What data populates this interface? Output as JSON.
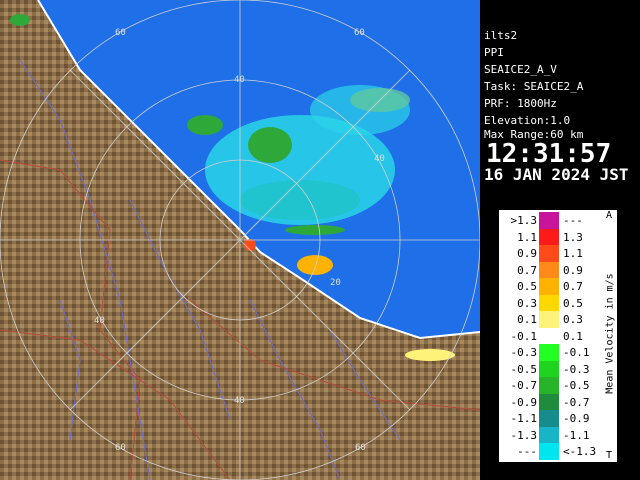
{
  "info": {
    "station": "ilts2",
    "mode": "PPI",
    "product": "SEAICE2_A_V",
    "task": "Task: SEAICE2_A",
    "prf": "PRF: 1800Hz",
    "elevation": "Elevation:1.0",
    "max_range": "Max Range:60 km",
    "time": "12:31:57",
    "date": "16 JAN 2024 JST"
  },
  "map": {
    "range_ring_labels": [
      "20",
      "40",
      "60",
      "40",
      "40",
      "60",
      "60",
      "40",
      "60"
    ],
    "colors": {
      "sea": "#1f6fe8",
      "land": "#8a6c46",
      "radar_echo_main": "#29d6e8",
      "radar_echo_green": "#2fa83a",
      "coast": "#ffffff"
    }
  },
  "legend": {
    "title": "Mean Velocity in m/s",
    "top_marker": "A",
    "bottom_marker": "T",
    "rows": [
      {
        "left": ">1.3",
        "right": "---",
        "color": "#c8149a"
      },
      {
        "left": "1.1",
        "right": "1.3",
        "color": "#ff1a1a"
      },
      {
        "left": "0.9",
        "right": "1.1",
        "color": "#ff4a1a"
      },
      {
        "left": "0.7",
        "right": "0.9",
        "color": "#ff8a1a"
      },
      {
        "left": "0.5",
        "right": "0.7",
        "color": "#ffb300"
      },
      {
        "left": "0.3",
        "right": "0.5",
        "color": "#ffd800"
      },
      {
        "left": "0.1",
        "right": "0.3",
        "color": "#fff27a"
      },
      {
        "left": "-0.1",
        "right": "0.1",
        "color": "#ffffff"
      },
      {
        "left": "-0.3",
        "right": "-0.1",
        "color": "#22ff22"
      },
      {
        "left": "-0.5",
        "right": "-0.3",
        "color": "#1fd41f"
      },
      {
        "left": "-0.7",
        "right": "-0.5",
        "color": "#28b428"
      },
      {
        "left": "-0.9",
        "right": "-0.7",
        "color": "#1e8c3c"
      },
      {
        "left": "-1.1",
        "right": "-0.9",
        "color": "#168c8c"
      },
      {
        "left": "-1.3",
        "right": "-1.1",
        "color": "#18b4c8"
      },
      {
        "left": "---",
        "right": "<-1.3",
        "color": "#00e6f0"
      }
    ]
  }
}
